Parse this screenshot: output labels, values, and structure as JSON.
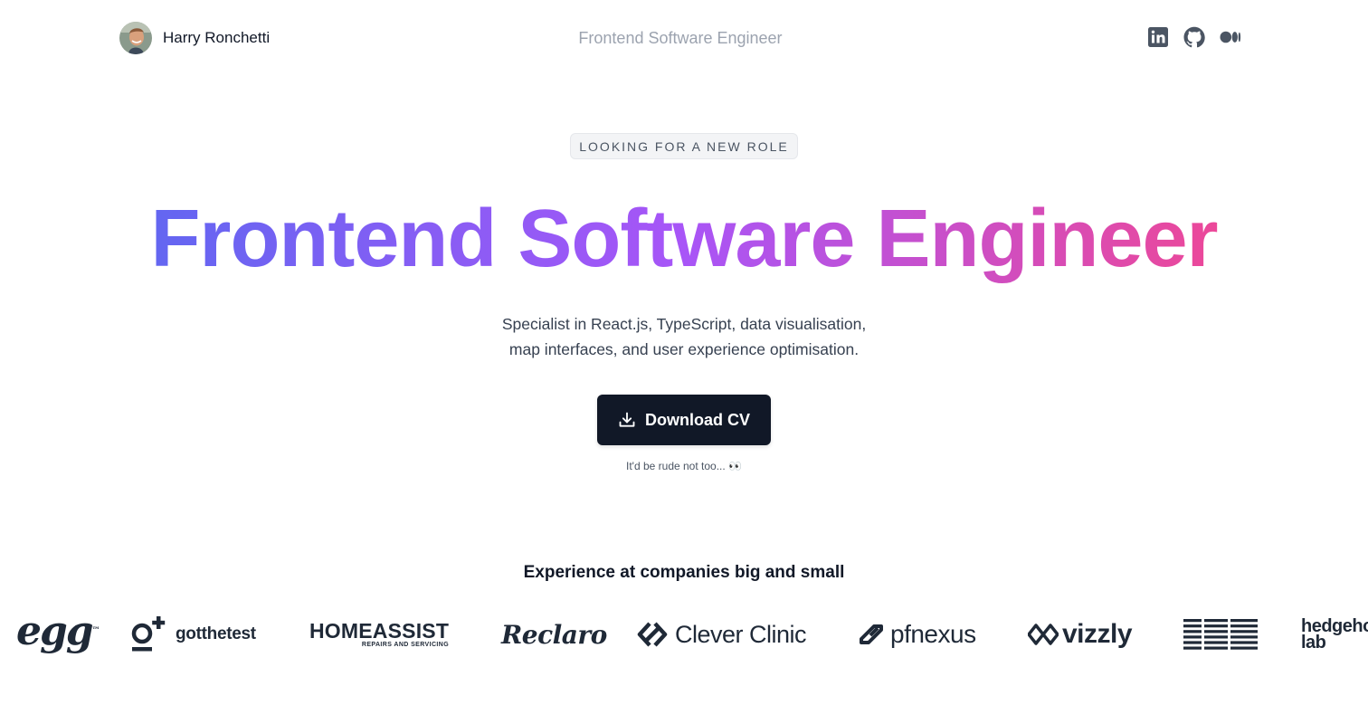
{
  "header": {
    "name": "Harry Ronchetti",
    "tagline": "Frontend Software Engineer",
    "socials": [
      {
        "name": "LinkedIn",
        "icon": "linkedin-icon"
      },
      {
        "name": "GitHub",
        "icon": "github-icon"
      },
      {
        "name": "Medium",
        "icon": "medium-icon"
      }
    ]
  },
  "hero": {
    "badge": "LOOKING FOR A NEW ROLE",
    "title": "Frontend Software Engineer",
    "subtitle_line1": "Specialist in React.js, TypeScript, data visualisation,",
    "subtitle_line2": "map interfaces, and user experience optimisation.",
    "cta_label": "Download CV",
    "cta_icon": "download-icon",
    "cta_note": "It'd be rude not too... 👀"
  },
  "experience": {
    "title": "Experience at companies big and small",
    "logos": {
      "egg": "egg",
      "egg_mark": "™",
      "gotthetest": "gotthetest",
      "homeassist": "HOMEASSIST",
      "homeassist_sub": "REPAIRS AND SERVICING",
      "reclaro": "Reclaro",
      "clever_clinic": "Clever Clinic",
      "pfnexus": "pfnexus",
      "vizzly": "vizzly",
      "ibm": "IBM",
      "hedgehog_1": "hedgehog",
      "hedgehog_2": "lab"
    }
  },
  "colors": {
    "gradient_start": "#6366f1",
    "gradient_mid": "#a855f7",
    "gradient_end": "#ec4899",
    "button_bg": "#111827",
    "muted_text": "#9ca3af"
  }
}
